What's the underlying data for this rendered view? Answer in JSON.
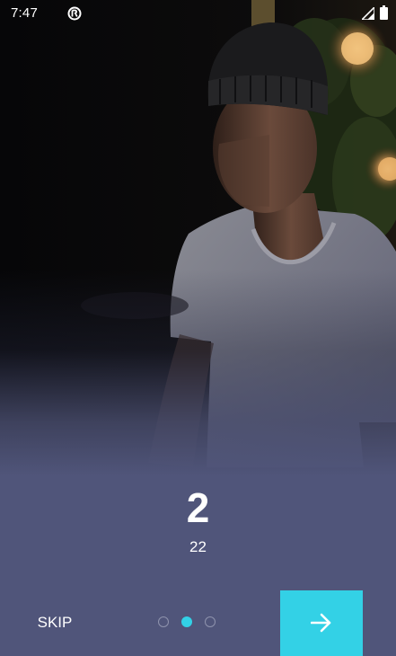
{
  "status_bar": {
    "time": "7:47",
    "icons": [
      "app-notification-icon",
      "signal-icon",
      "battery-icon"
    ]
  },
  "onboarding": {
    "page_number": "2",
    "subtitle": "22",
    "current_page": 2,
    "total_pages": 3
  },
  "controls": {
    "skip_label": "SKIP",
    "next_icon": "arrow-right-icon"
  },
  "colors": {
    "accent": "#33d1e6",
    "background": "#50557a",
    "text": "#ffffff",
    "dot_inactive": "#8f93ad"
  }
}
